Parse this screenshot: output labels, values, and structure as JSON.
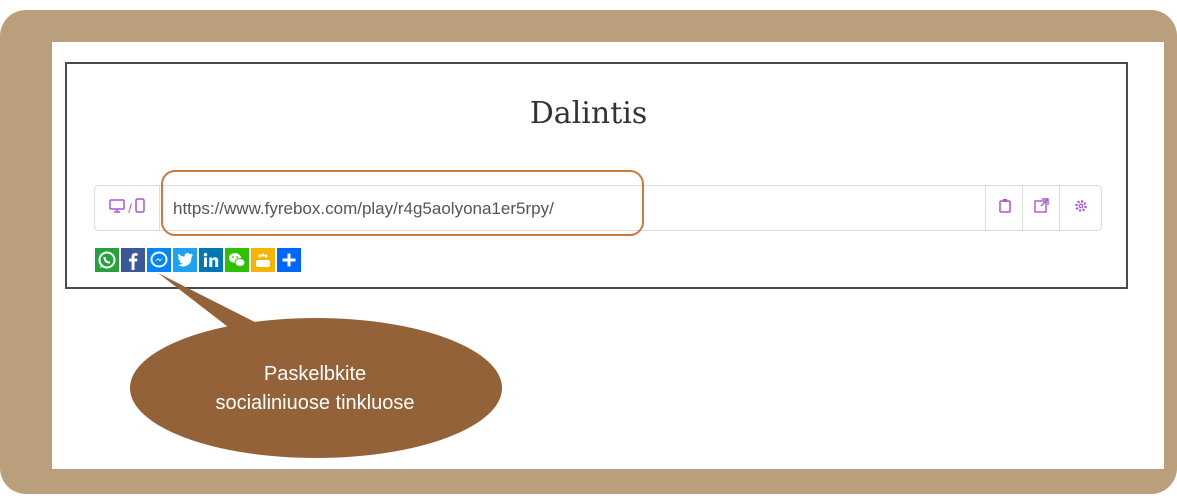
{
  "dialog": {
    "title": "Dalintis",
    "share_url": "https://www.fyrebox.com/play/r4g5aolyona1er5rpy/",
    "device_separator": "/"
  },
  "share_icons": [
    {
      "name": "whatsapp",
      "color": "#25a33a"
    },
    {
      "name": "facebook",
      "color": "#3b5998"
    },
    {
      "name": "messenger",
      "color": "#0084ff"
    },
    {
      "name": "twitter",
      "color": "#1da1f2"
    },
    {
      "name": "linkedin",
      "color": "#0077b5"
    },
    {
      "name": "wechat",
      "color": "#2dc100"
    },
    {
      "name": "sharethis",
      "color": "#f5b400"
    },
    {
      "name": "more",
      "color": "#0166ff"
    }
  ],
  "callout": {
    "line1": "Paskelbkite",
    "line2": "socialiniuose tinkluose",
    "color": "#946238"
  },
  "colors": {
    "frame": "#b99f7b",
    "highlight": "#d0773c",
    "accent_purple": "#a855d6"
  }
}
